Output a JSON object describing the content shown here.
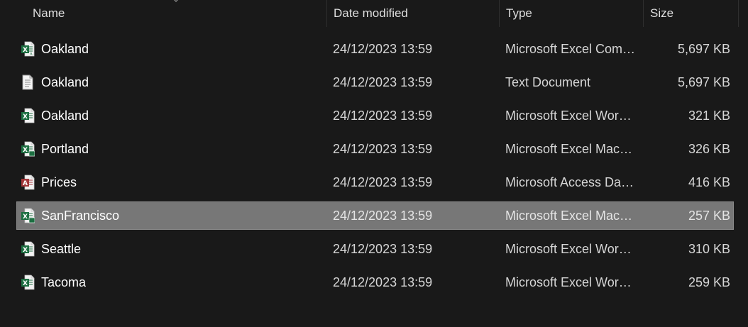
{
  "columns": {
    "name": "Name",
    "date_modified": "Date modified",
    "type": "Type",
    "size": "Size"
  },
  "files": [
    {
      "name": "Oakland",
      "date_modified": "24/12/2023 13:59",
      "type": "Microsoft Excel Com…",
      "size": "5,697 KB",
      "icon": "excel-csv-icon",
      "selected": false
    },
    {
      "name": "Oakland",
      "date_modified": "24/12/2023 13:59",
      "type": "Text Document",
      "size": "5,697 KB",
      "icon": "text-document-icon",
      "selected": false
    },
    {
      "name": "Oakland",
      "date_modified": "24/12/2023 13:59",
      "type": "Microsoft Excel Work…",
      "size": "321 KB",
      "icon": "excel-workbook-icon",
      "selected": false
    },
    {
      "name": "Portland",
      "date_modified": "24/12/2023 13:59",
      "type": "Microsoft Excel Macr…",
      "size": "326 KB",
      "icon": "excel-macro-icon",
      "selected": false
    },
    {
      "name": "Prices",
      "date_modified": "24/12/2023 13:59",
      "type": "Microsoft Access Dat…",
      "size": "416 KB",
      "icon": "access-database-icon",
      "selected": false
    },
    {
      "name": "SanFrancisco",
      "date_modified": "24/12/2023 13:59",
      "type": "Microsoft Excel Macr…",
      "size": "257 KB",
      "icon": "excel-macro-icon",
      "selected": true
    },
    {
      "name": "Seattle",
      "date_modified": "24/12/2023 13:59",
      "type": "Microsoft Excel Work…",
      "size": "310 KB",
      "icon": "excel-workbook-icon",
      "selected": false
    },
    {
      "name": "Tacoma",
      "date_modified": "24/12/2023 13:59",
      "type": "Microsoft Excel Work…",
      "size": "259 KB",
      "icon": "excel-workbook-icon",
      "selected": false
    }
  ],
  "colors": {
    "background": "#191919",
    "selection": "#777777",
    "excel_green": "#1d6f42",
    "access_red": "#a4373a"
  }
}
